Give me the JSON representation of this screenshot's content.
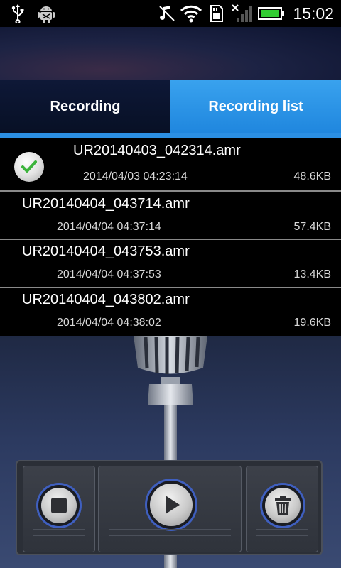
{
  "status_bar": {
    "time": "15:02",
    "icons": [
      "usb-icon",
      "android-debug-icon",
      "mute-icon",
      "wifi-icon",
      "sd-card-icon",
      "no-signal-icon",
      "battery-icon"
    ],
    "battery_color": "#33cc33"
  },
  "tabs": {
    "recording_label": "Recording",
    "list_label": "Recording list",
    "active": "Recording list",
    "active_color": "#2b8fe3"
  },
  "recordings": [
    {
      "name": "UR20140403_042314.amr",
      "date": "2014/04/03 04:23:14",
      "size": "48.6KB",
      "selected": true
    },
    {
      "name": "UR20140404_043714.amr",
      "date": "2014/04/04 04:37:14",
      "size": "57.4KB",
      "selected": false
    },
    {
      "name": "UR20140404_043753.amr",
      "date": "2014/04/04 04:37:53",
      "size": "13.4KB",
      "selected": false
    },
    {
      "name": "UR20140404_043802.amr",
      "date": "2014/04/04 04:38:02",
      "size": "19.6KB",
      "selected": false
    }
  ],
  "controls": {
    "stop": "stop-icon",
    "play": "play-icon",
    "delete": "trash-icon"
  }
}
